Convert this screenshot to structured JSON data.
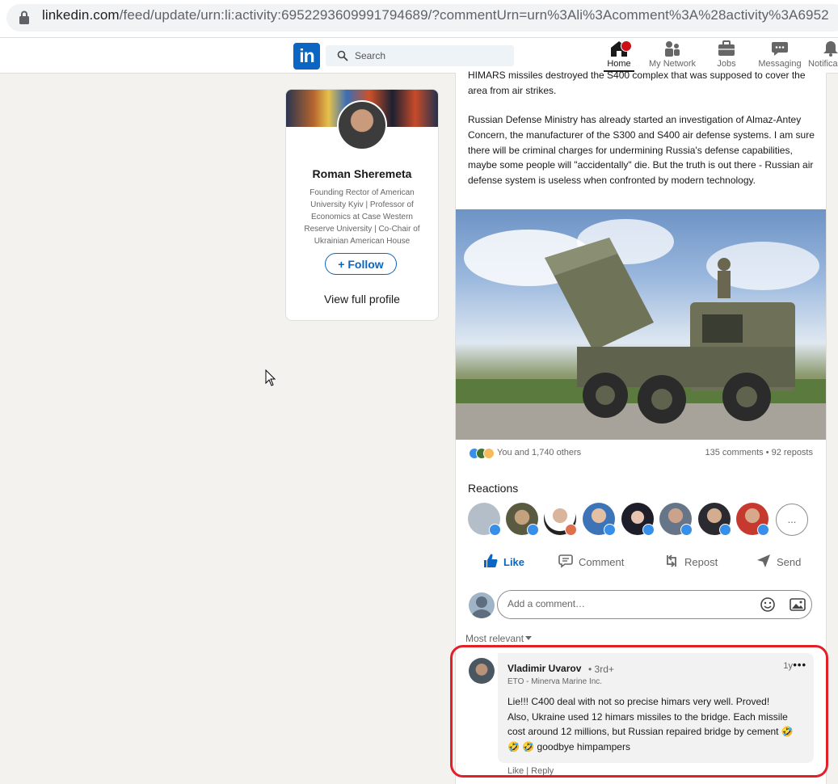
{
  "browser": {
    "url_domain": "linkedin.com",
    "url_path": "/feed/update/urn:li:activity:6952293609991794689/?commentUrn=urn%3Ali%3Acomment%3A%28activity%3A6952"
  },
  "nav": {
    "logo": "in",
    "search_placeholder": "Search",
    "items": [
      {
        "label": "Home"
      },
      {
        "label": "My Network"
      },
      {
        "label": "Jobs"
      },
      {
        "label": "Messaging"
      },
      {
        "label": "Notifica"
      }
    ]
  },
  "profile": {
    "name": "Roman Sheremeta",
    "headline": "Founding Rector of American University Kyiv | Professor of Economics at Case Western Reserve University | Co-Chair of Ukrainian American House",
    "follow_label": "+ Follow",
    "view_profile_label": "View full profile"
  },
  "post": {
    "text_top": "HIMARS missiles destroyed the S400 complex that was supposed to cover the area from air strikes.",
    "text_main": "Russian Defense Ministry has already started an investigation of Almaz-Antey Concern, the manufacturer of the S300 and S400 air defense systems. I am sure there will be criminal charges for undermining Russia's defense capabilities, maybe some people will \"accidentally\" die. But the truth is out there - Russian air defense system is useless when confronted by modern technology.",
    "reactions_summary": "You and 1,740 others",
    "stats": "135 comments • 92 reposts",
    "reactions_title": "Reactions",
    "reactions_more": "...",
    "actions": {
      "like": "Like",
      "comment": "Comment",
      "repost": "Repost",
      "send": "Send"
    },
    "comment_placeholder": "Add a comment…",
    "sort_label": "Most relevant"
  },
  "comment": {
    "author": "Vladimir Uvarov",
    "degree": "• 3rd+",
    "time": "1y",
    "menu": "•••",
    "subtitle": "ETO - Minerva Marine Inc.",
    "body": "Lie!!! C400 deal with not so precise himars very well. Proved!\n Also, Ukraine used 12 himars missiles to the bridge. Each missile cost around 12 millions, but Russian repaired bridge by cement 🤣 🤣 🤣 goodbye himpampers",
    "actions": "Like  |  Reply"
  },
  "colors": {
    "brand": "#0a66c2",
    "highlight": "#e1202a",
    "page_bg": "#f3f2ef"
  }
}
